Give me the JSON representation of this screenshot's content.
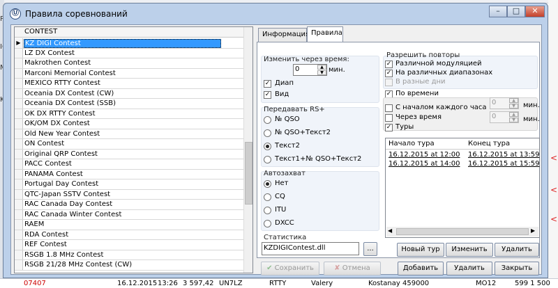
{
  "window": {
    "title": "Правила соревнований",
    "icon": "app-icon",
    "minimize": "–",
    "maximize": "□",
    "close": "✕"
  },
  "contest_list": {
    "header": "CONTEST",
    "selected_index": 0,
    "items": [
      "KZ DIGI Contest",
      "LZ DX Contest",
      "Makrothen Contest",
      "Marconi Memorial Contest",
      "MEXICO RTTY Contest",
      "Oceania DX Contest (CW)",
      "Oceania DX Contest (SSB)",
      "OK DX RTTY Contest",
      "OK/OM DX Contest",
      "Old New Year Contest",
      "ON Contest",
      "Original QRP Contest",
      "PACC Contest",
      "PANAMA Contest",
      "Portugal Day Contest",
      "QTC-Japan SSTV Contest",
      "RAC Canada Day Contest",
      "RAC Canada Winter Contest",
      "RAEM",
      "RDA Contest",
      "REF Contest",
      "RSGB 1.8 MHz Contest",
      "RSGB 21/28 MHz Contest (CW)"
    ]
  },
  "tabs": [
    {
      "label": "Информация",
      "active": false
    },
    {
      "label": "Правила",
      "active": true
    }
  ],
  "change_interval": {
    "label": "Изменить через время:",
    "value": "0",
    "unit": "мин.",
    "band": {
      "label": "Диап",
      "checked": true
    },
    "mode": {
      "label": "Вид",
      "checked": true
    }
  },
  "transmit_rs": {
    "label": "Передавать RS+",
    "options": [
      "№ QSO",
      "№ QSO+Текст2",
      "Текст2",
      "Текст1+№ QSO+Текст2"
    ],
    "selected": 2
  },
  "autocapture": {
    "label": "Автозахват",
    "options": [
      "Нет",
      "CQ",
      "ITU",
      "DXCC"
    ],
    "selected": 0
  },
  "statistics": {
    "label": "Статистика",
    "value": "KZDIGIContest.dll",
    "browse": "..."
  },
  "repeats": {
    "label": "Разрешить повторы",
    "items": [
      {
        "label": "Различной модуляцией",
        "checked": true,
        "enabled": true
      },
      {
        "label": "На различных диапазонах",
        "checked": true,
        "enabled": true
      },
      {
        "label": "В разные дни",
        "checked": false,
        "enabled": false
      }
    ],
    "by_time": {
      "label": "По времени",
      "checked": true
    },
    "hourly": {
      "label": "С началом каждого часа",
      "checked": false,
      "value": "0",
      "unit": "мин."
    },
    "after": {
      "label": "Через время",
      "checked": false,
      "value": "0",
      "unit": "мин."
    },
    "tours": {
      "label": "Туры",
      "checked": true
    }
  },
  "tours_table": {
    "columns": [
      "Начало тура",
      "Конец тура"
    ],
    "rows": [
      [
        "16.12.2015 at 12:00",
        "16.12.2015 at 13:59"
      ],
      [
        "16.12.2015 at 14:00",
        "16.12.2015 at 15:59"
      ]
    ]
  },
  "tour_buttons": {
    "new": "Новый тур",
    "edit": "Изменить",
    "delete": "Удалить"
  },
  "footer": {
    "save": "Сохранить",
    "cancel": "Отмена",
    "add": "Добавить",
    "delete": "Удалить",
    "close": "Закрыть"
  },
  "background": {
    "left_letters": [
      "Ра",
      "IC",
      "М",
      "Ke"
    ],
    "bottom_row": [
      "16.12.2015",
      "13:26",
      "3 597,42",
      "UN7LZ",
      "RTTY",
      "Valery",
      "Kostanay 459000",
      "MO12",
      "599 1 500"
    ],
    "bottom_left": "07407"
  },
  "colors": {
    "selection": "#3399ff",
    "window_frame": "#bcd0ea",
    "close_button": "#c4402a"
  }
}
